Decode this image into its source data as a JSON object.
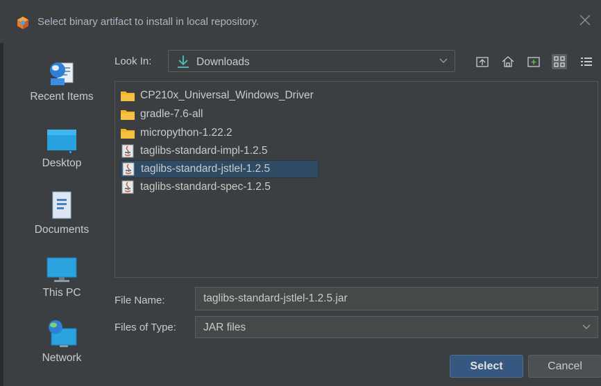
{
  "window": {
    "title": "Select binary artifact to install in local repository."
  },
  "places": [
    {
      "label": "Recent Items",
      "icon": "recent-items-icon"
    },
    {
      "label": "Desktop",
      "icon": "desktop-icon"
    },
    {
      "label": "Documents",
      "icon": "documents-icon"
    },
    {
      "label": "This PC",
      "icon": "this-pc-icon"
    },
    {
      "label": "Network",
      "icon": "network-icon"
    }
  ],
  "look_in": {
    "label": "Look In:",
    "value": "Downloads"
  },
  "toolbar": {
    "buttons": [
      "up-one-level-icon",
      "home-icon",
      "new-folder-icon",
      "list-view-icon",
      "details-view-icon"
    ]
  },
  "files": [
    {
      "name": "CP210x_Universal_Windows_Driver",
      "type": "folder"
    },
    {
      "name": "gradle-7.6-all",
      "type": "folder"
    },
    {
      "name": "micropython-1.22.2",
      "type": "folder"
    },
    {
      "name": "taglibs-standard-impl-1.2.5",
      "type": "jar"
    },
    {
      "name": "taglibs-standard-jstlel-1.2.5",
      "type": "jar",
      "selected": true
    },
    {
      "name": "taglibs-standard-spec-1.2.5",
      "type": "jar"
    }
  ],
  "file_name": {
    "label": "File Name:",
    "value": "taglibs-standard-jstlel-1.2.5.jar"
  },
  "file_type": {
    "label": "Files of Type:",
    "value": "JAR files"
  },
  "buttons": {
    "select": "Select",
    "cancel": "Cancel"
  },
  "colors": {
    "background": "#3c3f41",
    "selection": "#2f4a63",
    "primary_button": "#365880",
    "folder": "#f0b429"
  }
}
